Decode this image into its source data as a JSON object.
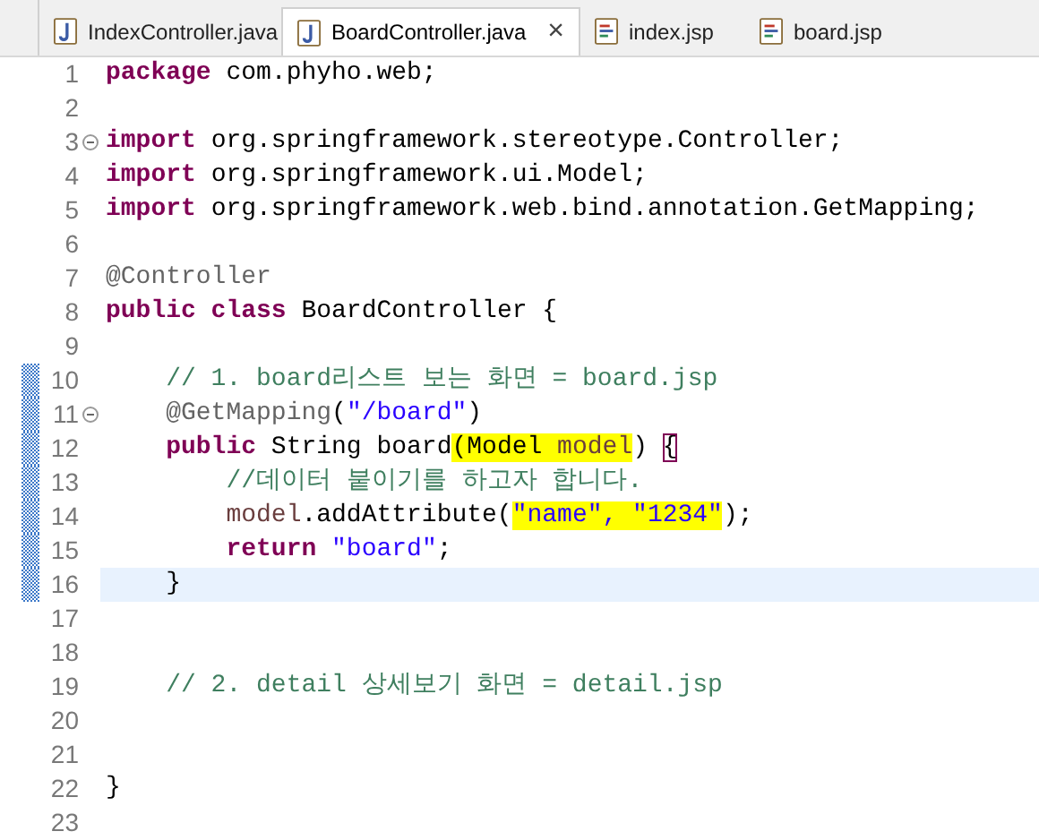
{
  "tabs": [
    {
      "label": "IndexController.java",
      "kind": "java",
      "selected": false
    },
    {
      "label": "BoardController.java",
      "kind": "java",
      "selected": true,
      "close": "×"
    },
    {
      "label": "index.jsp",
      "kind": "jsp",
      "selected": false
    },
    {
      "label": "board.jsp",
      "kind": "jsp",
      "selected": false
    }
  ],
  "lines": [
    {
      "number": "1",
      "changed": false,
      "fold": false,
      "current": false,
      "tokens": [
        {
          "kind": "keyword",
          "text": "package"
        },
        {
          "kind": "plain",
          "text": " com.phyho.web;"
        }
      ]
    },
    {
      "number": "2",
      "changed": false,
      "fold": false,
      "current": false
    },
    {
      "number": "3",
      "changed": false,
      "fold": true,
      "current": false,
      "tokens": [
        {
          "kind": "keyword",
          "text": "import"
        },
        {
          "kind": "plain",
          "text": " org.springframework.stereotype.Controller;"
        }
      ]
    },
    {
      "number": "4",
      "changed": false,
      "fold": false,
      "current": false,
      "tokens": [
        {
          "kind": "keyword",
          "text": "import"
        },
        {
          "kind": "plain",
          "text": " org.springframework.ui.Model;"
        }
      ]
    },
    {
      "number": "5",
      "changed": false,
      "fold": false,
      "current": false,
      "tokens": [
        {
          "kind": "keyword",
          "text": "import"
        },
        {
          "kind": "plain",
          "text": " org.springframework.web.bind.annotation.GetMapping;"
        }
      ]
    },
    {
      "number": "6",
      "changed": false,
      "fold": false,
      "current": false
    },
    {
      "number": "7",
      "changed": false,
      "fold": false,
      "current": false,
      "tokens": [
        {
          "kind": "annotation",
          "text": "@Controller"
        }
      ]
    },
    {
      "number": "8",
      "changed": false,
      "fold": false,
      "current": false,
      "tokens": [
        {
          "kind": "keyword",
          "text": "public class"
        },
        {
          "kind": "plain",
          "text": " BoardController {"
        }
      ]
    },
    {
      "number": "9",
      "changed": false,
      "fold": false,
      "current": false
    },
    {
      "number": "10",
      "changed": true,
      "fold": false,
      "current": false,
      "tokens": [
        {
          "kind": "comment",
          "text": "    // 1. board리스트 보는 화면 = board.jsp"
        }
      ]
    },
    {
      "number": "11",
      "changed": true,
      "fold": true,
      "current": false,
      "tokens": [
        {
          "kind": "annotation",
          "text": "    @GetMapping"
        },
        {
          "kind": "plain",
          "text": "("
        },
        {
          "kind": "string",
          "text": "\"/board\""
        },
        {
          "kind": "plain",
          "text": ")"
        }
      ]
    },
    {
      "number": "12",
      "changed": true,
      "fold": false,
      "current": false,
      "tokens": [
        {
          "kind": "keyword",
          "text": "    public"
        },
        {
          "kind": "plain",
          "text": " String board"
        },
        {
          "kind": "plain",
          "text": "(Model ",
          "highlight": true
        },
        {
          "kind": "variable",
          "text": "model",
          "highlight": true
        },
        {
          "kind": "plain",
          "text": ") "
        },
        {
          "kind": "bracket",
          "text": "{"
        }
      ]
    },
    {
      "number": "13",
      "changed": true,
      "fold": false,
      "current": false,
      "tokens": [
        {
          "kind": "comment",
          "text": "        //데이터 붙이기를 하고자 합니다."
        }
      ]
    },
    {
      "number": "14",
      "changed": true,
      "fold": false,
      "current": false,
      "tokens": [
        {
          "kind": "variable",
          "text": "        model"
        },
        {
          "kind": "plain",
          "text": ".addAttribute("
        },
        {
          "kind": "string",
          "text": "\"name\", \"1234\"",
          "highlight": true
        },
        {
          "kind": "plain",
          "text": ");"
        }
      ]
    },
    {
      "number": "15",
      "changed": true,
      "fold": false,
      "current": false,
      "tokens": [
        {
          "kind": "keyword",
          "text": "        return "
        },
        {
          "kind": "string",
          "text": "\"board\""
        },
        {
          "kind": "plain",
          "text": ";"
        }
      ]
    },
    {
      "number": "16",
      "changed": true,
      "fold": false,
      "current": true,
      "tokens": [
        {
          "kind": "plain",
          "text": "    }"
        }
      ]
    },
    {
      "number": "17",
      "changed": false,
      "fold": false,
      "current": false
    },
    {
      "number": "18",
      "changed": false,
      "fold": false,
      "current": false
    },
    {
      "number": "19",
      "changed": false,
      "fold": false,
      "current": false,
      "tokens": [
        {
          "kind": "comment",
          "text": "    // 2. detail 상세보기 화면 = detail.jsp"
        }
      ]
    },
    {
      "number": "20",
      "changed": false,
      "fold": false,
      "current": false
    },
    {
      "number": "21",
      "changed": false,
      "fold": false,
      "current": false
    },
    {
      "number": "22",
      "changed": false,
      "fold": false,
      "current": false,
      "tokens": [
        {
          "kind": "plain",
          "text": "}"
        }
      ]
    },
    {
      "number": "23",
      "changed": false,
      "fold": false,
      "current": false
    }
  ]
}
